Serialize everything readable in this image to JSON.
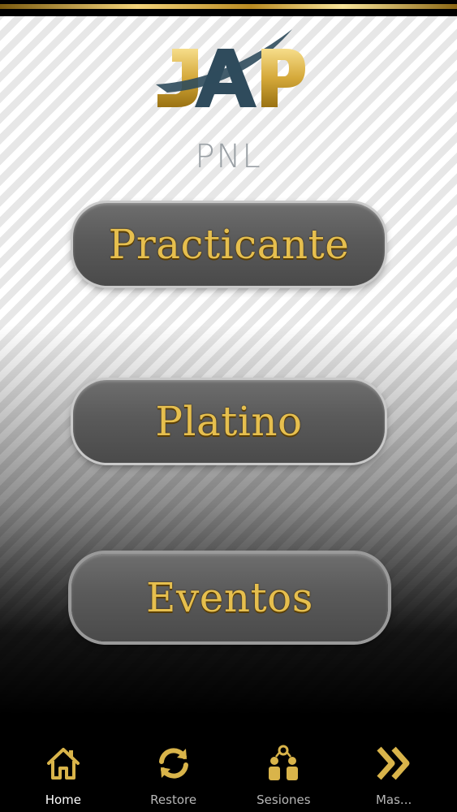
{
  "logo": {
    "letters": "JAP",
    "subtitle": "PNL"
  },
  "menu": {
    "practicante": "Practicante",
    "platino": "Platino",
    "eventos": "Eventos"
  },
  "nav": {
    "items": [
      {
        "label": "Home",
        "icon": "home-icon",
        "active": true
      },
      {
        "label": "Restore",
        "icon": "refresh-icon",
        "active": false
      },
      {
        "label": "Sesiones",
        "icon": "sessions-icon",
        "active": false
      },
      {
        "label": "Mas...",
        "icon": "double-chevron-right-icon",
        "active": false
      }
    ]
  },
  "colors": {
    "gold": "#e6bf4e",
    "button": "#5a5a5a",
    "logo_blue": "#2f4b5c"
  }
}
